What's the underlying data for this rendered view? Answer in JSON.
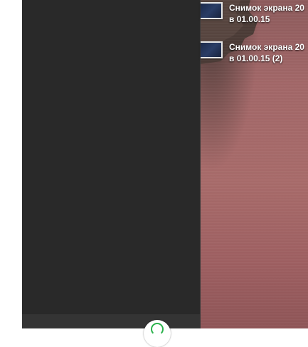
{
  "desktop": {
    "files": [
      {
        "name_line1": "Снимок экрана 20",
        "name_line2": "в 01.00.15"
      },
      {
        "name_line1": "Снимок экрана 20",
        "name_line2": "в 01.00.15 (2)"
      }
    ]
  },
  "fab": {
    "icon": "whatsapp-icon",
    "color": "#2bb24c"
  },
  "colors": {
    "panel": "#292929",
    "footer": "#343434",
    "wallpaper": "#a26768"
  }
}
